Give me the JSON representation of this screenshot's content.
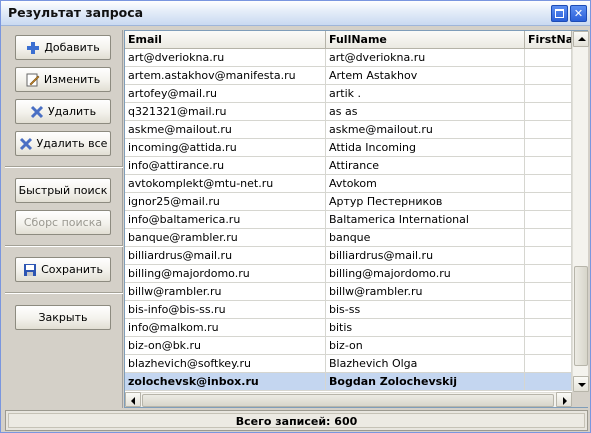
{
  "window": {
    "title": "Результат запроса"
  },
  "sidebar": {
    "add_label": "Добавить",
    "edit_label": "Изменить",
    "delete_label": "Удалить",
    "delete_all_label": "Удалить все",
    "quick_search_label": "Быстрый поиск",
    "reset_search_label": "Сборс поиска",
    "save_label": "Сохранить",
    "close_label": "Закрыть"
  },
  "grid": {
    "columns": [
      "Email",
      "FullName",
      "FirstName"
    ],
    "rows": [
      [
        "art@dveriokna.ru",
        "art@dveriokna.ru",
        ""
      ],
      [
        "artem.astakhov@manifesta.ru",
        "Artem Astakhov",
        ""
      ],
      [
        "artofey@mail.ru",
        "artik .",
        ""
      ],
      [
        "q321321@mail.ru",
        "as as",
        ""
      ],
      [
        "askme@mailout.ru",
        "askme@mailout.ru",
        ""
      ],
      [
        "incoming@attida.ru",
        "Attida Incoming",
        ""
      ],
      [
        "info@attirance.ru",
        "Attirance",
        ""
      ],
      [
        "avtokomplekt@mtu-net.ru",
        "Avtokom",
        ""
      ],
      [
        "ignor25@mail.ru",
        "Артур Пестерников",
        ""
      ],
      [
        "info@baltamerica.ru",
        "Baltamerica International",
        ""
      ],
      [
        "banque@rambler.ru",
        "banque",
        ""
      ],
      [
        "billiardrus@mail.ru",
        "billiardrus@mail.ru",
        ""
      ],
      [
        "billing@majordomo.ru",
        "billing@majordomo.ru",
        ""
      ],
      [
        "billw@rambler.ru",
        "billw@rambler.ru",
        ""
      ],
      [
        "bis-info@bis-ss.ru",
        "bis-ss",
        ""
      ],
      [
        "info@malkom.ru",
        "bitis",
        ""
      ],
      [
        "biz-on@bk.ru",
        "biz-on",
        ""
      ],
      [
        "blazhevich@softkey.ru",
        "Blazhevich Olga",
        ""
      ],
      [
        "zolochevsk@inbox.ru",
        "Bogdan Zolochevskij",
        ""
      ]
    ],
    "selected_row": 18
  },
  "status": {
    "total_label": "Всего записей: 600"
  },
  "colors": {
    "selection": "#c4d6f0",
    "title_gradient_end": "#c9d9f1",
    "panel": "#d4d0c8"
  }
}
